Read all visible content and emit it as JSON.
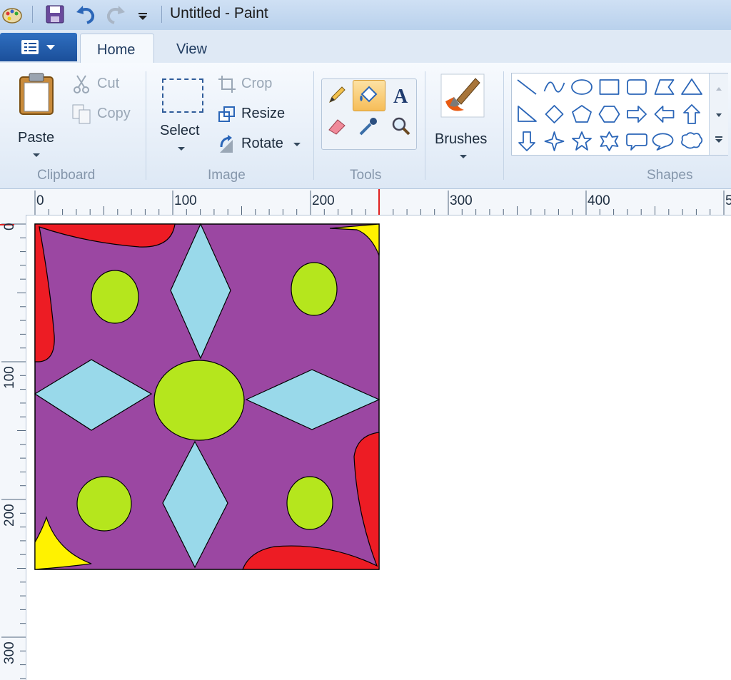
{
  "window": {
    "title": "Untitled - Paint"
  },
  "quick_access": {
    "items": [
      "paint-app-icon",
      "save-icon",
      "undo-icon",
      "redo-icon",
      "customize-dropdown-icon"
    ]
  },
  "tabs": [
    {
      "label": "Home",
      "selected": true
    },
    {
      "label": "View",
      "selected": false
    }
  ],
  "ribbon": {
    "clipboard": {
      "group_label": "Clipboard",
      "paste": "Paste",
      "cut": "Cut",
      "copy": "Copy"
    },
    "image": {
      "group_label": "Image",
      "select": "Select",
      "crop": "Crop",
      "resize": "Resize",
      "rotate": "Rotate"
    },
    "tools": {
      "group_label": "Tools",
      "selected_tool": "fill-bucket",
      "items": [
        "pencil-icon",
        "fill-bucket-icon",
        "text-icon",
        "eraser-icon",
        "color-picker-icon",
        "magnifier-icon"
      ]
    },
    "brushes": {
      "label": "Brushes"
    },
    "shapes": {
      "group_label": "Shapes",
      "items": [
        "line",
        "curve",
        "oval",
        "rectangle",
        "rounded-rectangle",
        "polygon",
        "triangle",
        "right-triangle",
        "diamond",
        "pentagon",
        "hexagon",
        "right-arrow",
        "left-arrow",
        "up-arrow",
        "down-arrow",
        "four-point-star",
        "five-point-star",
        "six-point-star",
        "rounded-callout",
        "oval-callout",
        "cloud-callout"
      ]
    }
  },
  "rulers": {
    "horizontal": [
      "0",
      "100",
      "200",
      "300",
      "400",
      "5"
    ],
    "vertical": [
      "0",
      "100",
      "200",
      "300"
    ]
  },
  "canvas": {
    "colors": {
      "background": "#9b47a2",
      "red": "#ed1c24",
      "yellow": "#fff200",
      "diamond": "#99d9ea",
      "circle": "#b5e61d",
      "outline": "#000000",
      "accent_blue": "#1b4f9a"
    }
  }
}
